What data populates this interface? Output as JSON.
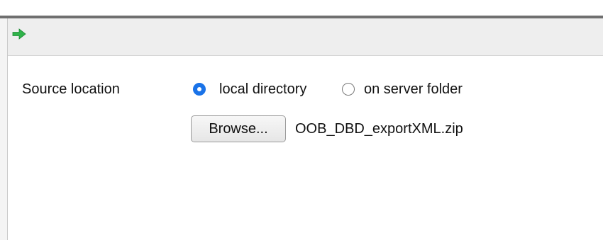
{
  "toolbar": {
    "action_icon": "green-right-arrow-icon",
    "icon_color": "#2fb34a"
  },
  "form": {
    "source_location_label": "Source location",
    "options": [
      {
        "label": "local directory",
        "checked": true
      },
      {
        "label": "on server folder",
        "checked": false
      }
    ],
    "browse_label": "Browse...",
    "selected_file": "OOB_DBD_exportXML.zip"
  },
  "colors": {
    "accent": "#1a73e8",
    "toolbar_bg": "#eeeeee",
    "border_dark": "#6f6f6f"
  }
}
